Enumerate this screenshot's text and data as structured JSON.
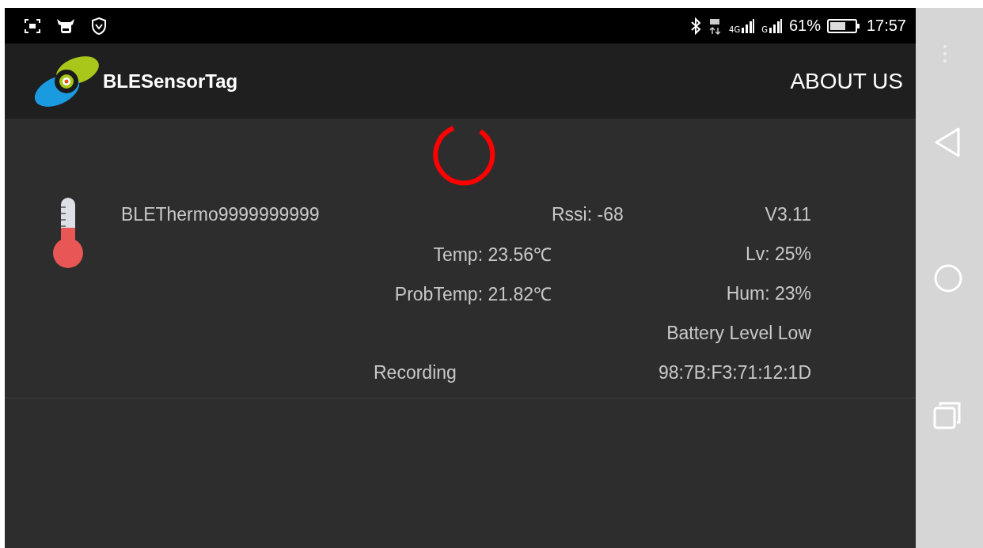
{
  "status_bar": {
    "network_labels": [
      "4G",
      "G"
    ],
    "battery": "61%",
    "time": "17:57"
  },
  "app_bar": {
    "title": "BLESensorTag",
    "action": "ABOUT US"
  },
  "devices": [
    {
      "name": "BLEThermo9999999999",
      "rssi": "Rssi: -68",
      "version": "V3.11",
      "temp": "Temp: 23.56℃",
      "lv": "Lv: 25%",
      "probe_temp": "ProbTemp: 21.82℃",
      "humidity": "Hum: 23%",
      "battery_status": "Battery Level Low",
      "recording": "Recording",
      "address": "98:7B:F3:71:12:1D"
    }
  ]
}
